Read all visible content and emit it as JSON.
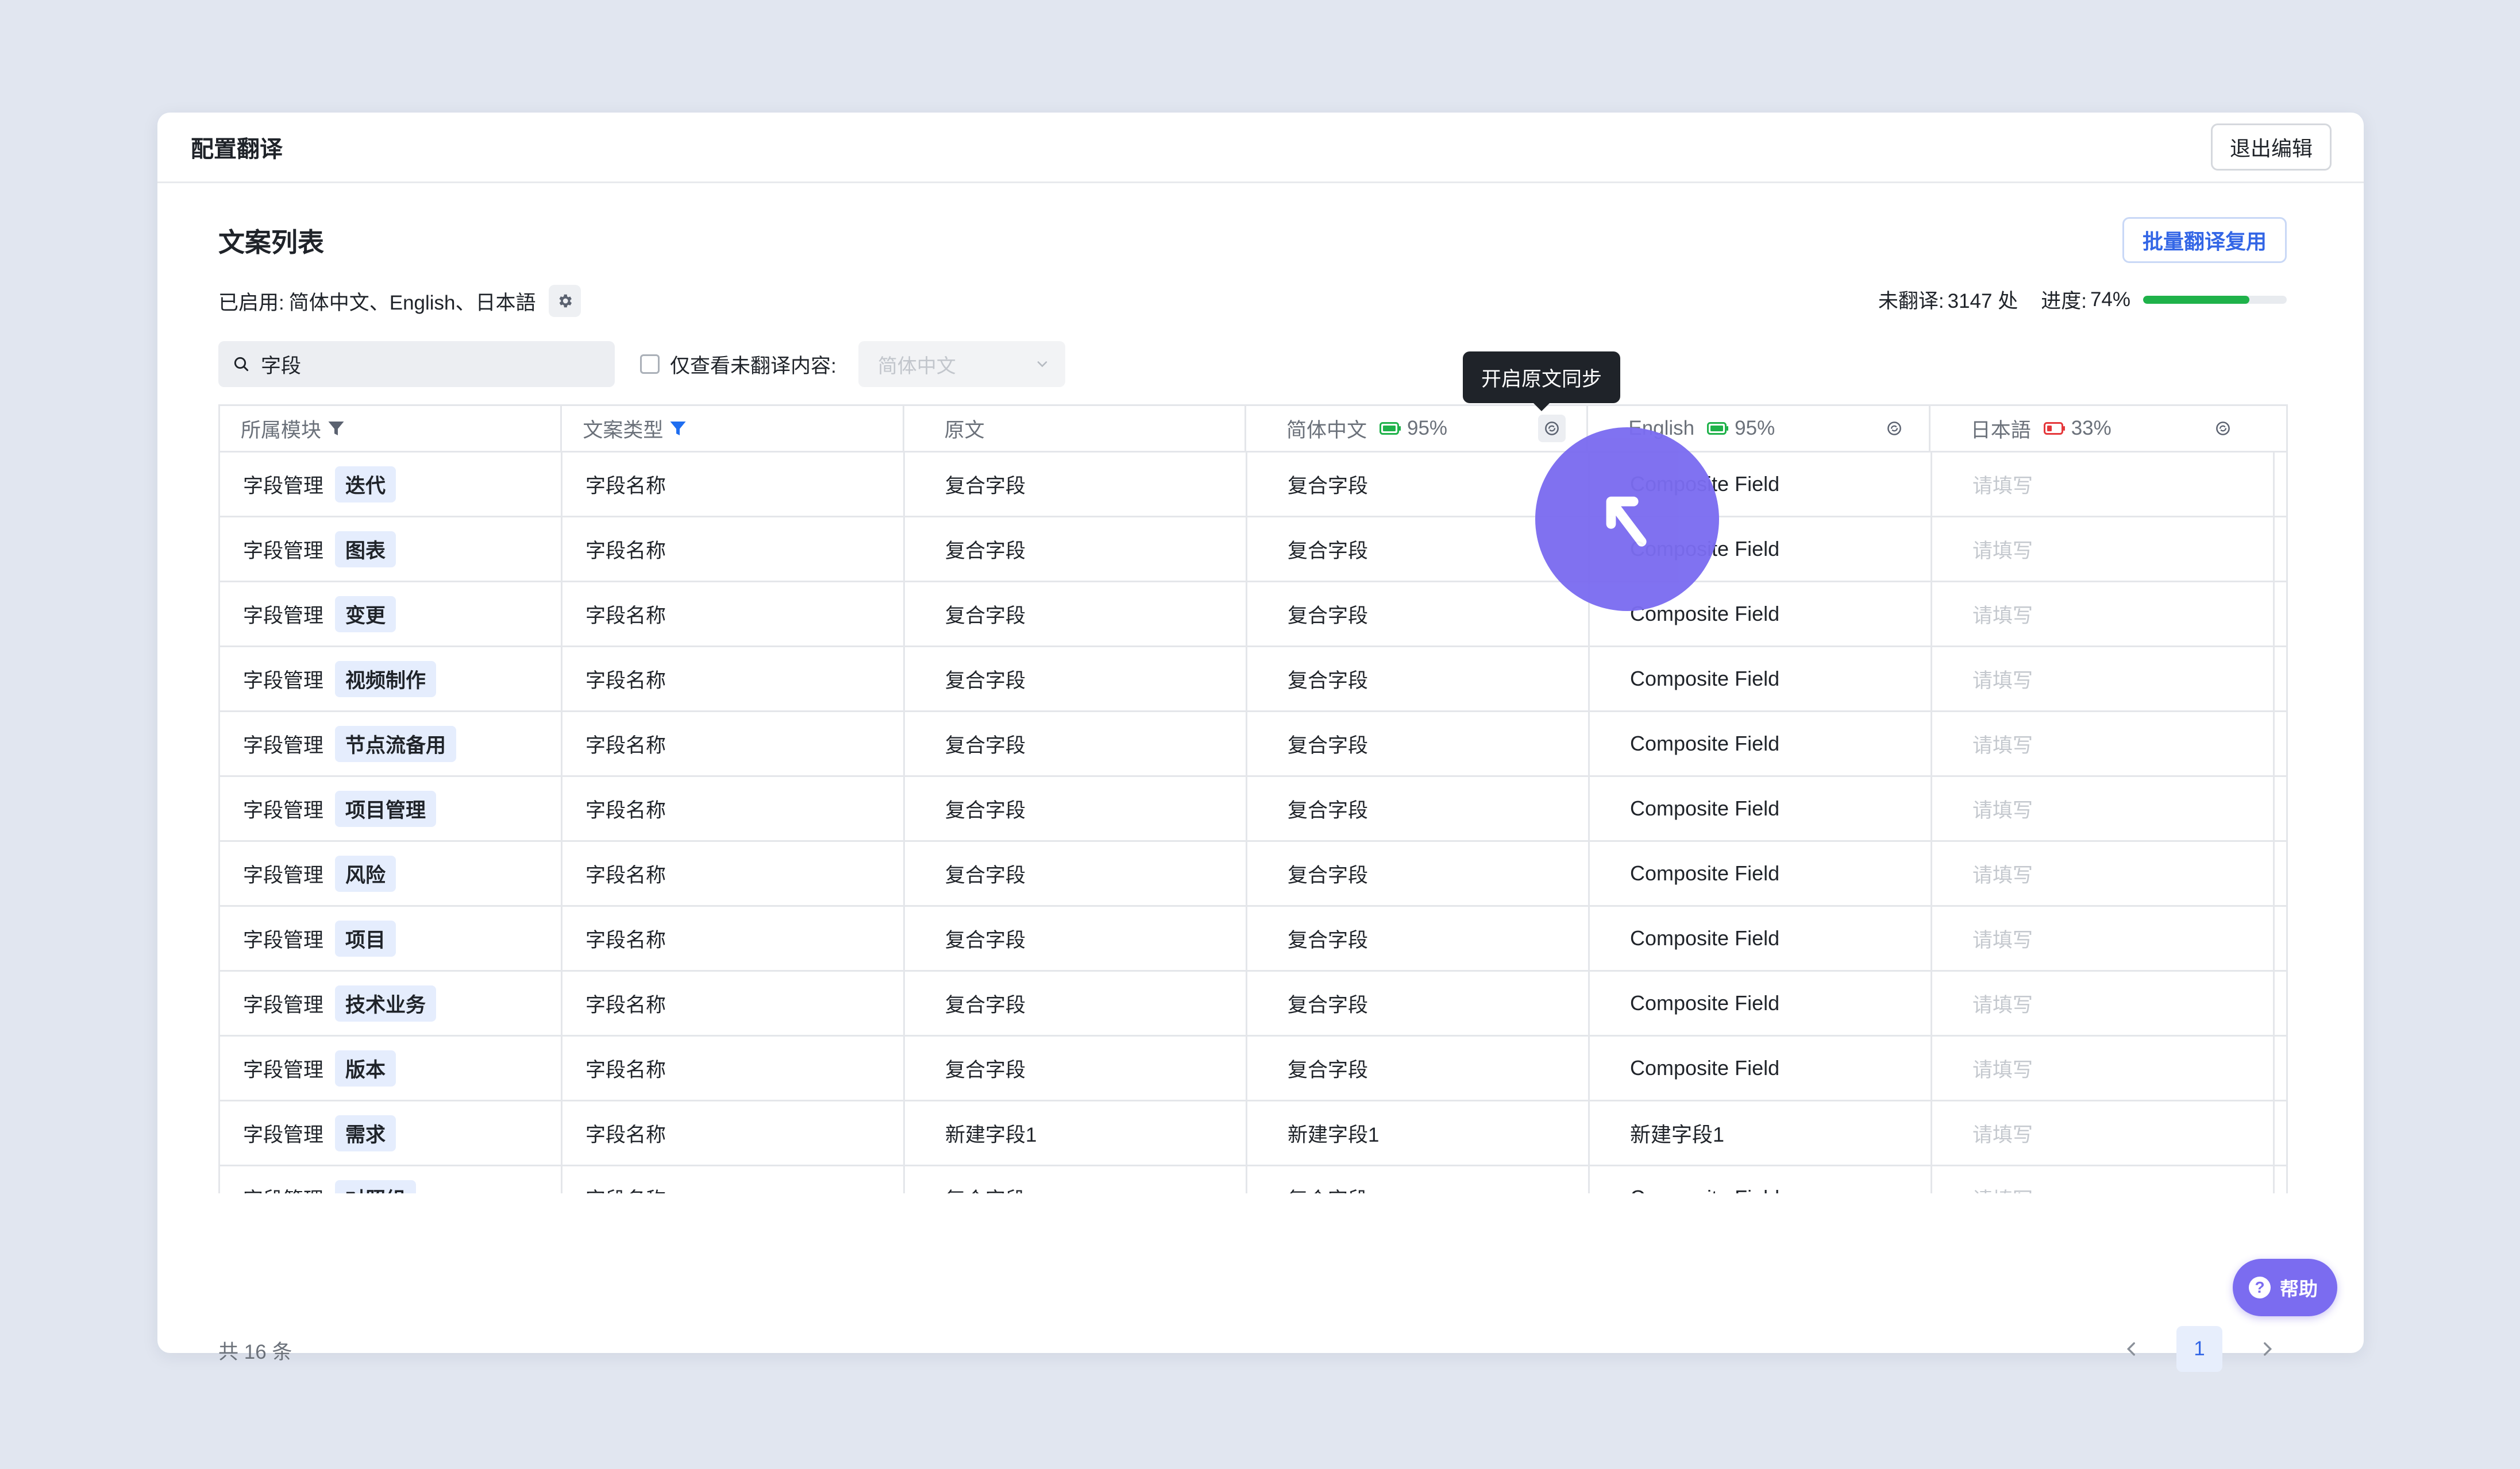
{
  "dialog": {
    "title": "配置翻译",
    "exit_button": "退出编辑"
  },
  "section": {
    "title": "文案列表",
    "batch_button": "批量翻译复用",
    "enabled_label": "已启用:",
    "enabled_languages": "简体中文、English、日本語",
    "untranslated_label": "未翻译:",
    "untranslated_value": "3147 处",
    "progress_label": "进度:",
    "progress_value": "74%",
    "progress_fraction": 0.74
  },
  "filters": {
    "search_value": "字段",
    "only_untranslated_label": "仅查看未翻译内容:",
    "language_select_placeholder": "简体中文"
  },
  "table": {
    "columns": {
      "module": "所属模块",
      "type": "文案类型",
      "source": "原文",
      "zh": "简体中文",
      "zh_pct": "95%",
      "en": "English",
      "en_pct": "95%",
      "ja": "日本語",
      "ja_pct": "33%"
    },
    "rows": [
      {
        "module": "字段管理",
        "tag": "迭代",
        "type": "字段名称",
        "source": "复合字段",
        "zh": "复合字段",
        "en": "Composite Field",
        "ja": "请填写"
      },
      {
        "module": "字段管理",
        "tag": "图表",
        "type": "字段名称",
        "source": "复合字段",
        "zh": "复合字段",
        "en": "Composite Field",
        "ja": "请填写"
      },
      {
        "module": "字段管理",
        "tag": "变更",
        "type": "字段名称",
        "source": "复合字段",
        "zh": "复合字段",
        "en": "Composite Field",
        "ja": "请填写"
      },
      {
        "module": "字段管理",
        "tag": "视频制作",
        "type": "字段名称",
        "source": "复合字段",
        "zh": "复合字段",
        "en": "Composite Field",
        "ja": "请填写"
      },
      {
        "module": "字段管理",
        "tag": "节点流备用",
        "type": "字段名称",
        "source": "复合字段",
        "zh": "复合字段",
        "en": "Composite Field",
        "ja": "请填写"
      },
      {
        "module": "字段管理",
        "tag": "项目管理",
        "type": "字段名称",
        "source": "复合字段",
        "zh": "复合字段",
        "en": "Composite Field",
        "ja": "请填写"
      },
      {
        "module": "字段管理",
        "tag": "风险",
        "type": "字段名称",
        "source": "复合字段",
        "zh": "复合字段",
        "en": "Composite Field",
        "ja": "请填写"
      },
      {
        "module": "字段管理",
        "tag": "项目",
        "type": "字段名称",
        "source": "复合字段",
        "zh": "复合字段",
        "en": "Composite Field",
        "ja": "请填写"
      },
      {
        "module": "字段管理",
        "tag": "技术业务",
        "type": "字段名称",
        "source": "复合字段",
        "zh": "复合字段",
        "en": "Composite Field",
        "ja": "请填写"
      },
      {
        "module": "字段管理",
        "tag": "版本",
        "type": "字段名称",
        "source": "复合字段",
        "zh": "复合字段",
        "en": "Composite Field",
        "ja": "请填写"
      },
      {
        "module": "字段管理",
        "tag": "需求",
        "type": "字段名称",
        "source": "新建字段1",
        "zh": "新建字段1",
        "en": "新建字段1",
        "ja": "请填写"
      },
      {
        "module": "字段管理",
        "tag": "对照组",
        "type": "字段名称",
        "source": "复合字段",
        "zh": "复合字段",
        "en": "Composite Field",
        "ja": "请填写"
      }
    ]
  },
  "tooltip": {
    "text": "开启原文同步"
  },
  "footer": {
    "total": "共 16 条",
    "current_page": "1",
    "help_label": "帮助"
  },
  "colors": {
    "accent": "#3366e6",
    "progress": "#1fb24a",
    "cursor": "#7b6cf0",
    "badge_green": "#1fb24a",
    "badge_red": "#e5383b"
  },
  "icons": {
    "header_filter": "filter-icon",
    "active_filter": "filter-active-icon",
    "sync": "sync-icon",
    "settings": "gear-icon",
    "search": "search-icon",
    "pointer": "arrow-pointer-icon"
  }
}
